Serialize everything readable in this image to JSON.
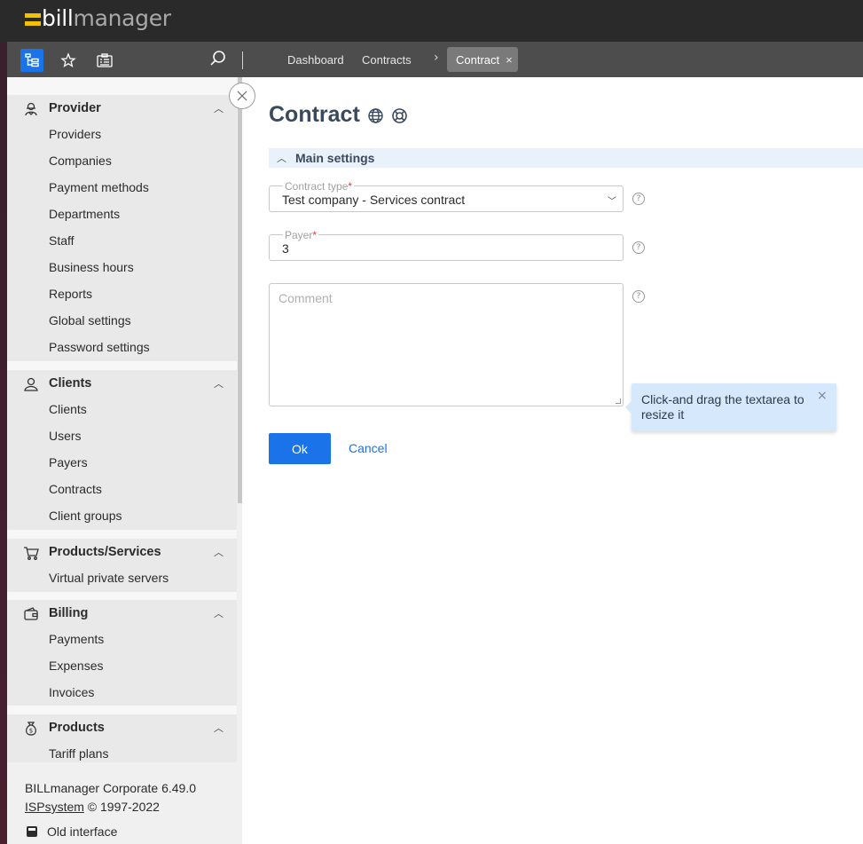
{
  "app": {
    "logo_bill": "bill",
    "logo_manager": "manager",
    "accent": "#1a73e8",
    "logo_color": "#f2c200"
  },
  "toolbar": {
    "icons": [
      "tree-menu-icon",
      "star-icon",
      "clipboard-icon",
      "search-icon"
    ],
    "breadcrumbs": [
      "Dashboard",
      "Contracts"
    ],
    "active_tab": "Contract",
    "active_tab_close": "×"
  },
  "sidebar": {
    "sections": [
      {
        "title": "Provider",
        "icon": "provider-icon",
        "items": [
          "Providers",
          "Companies",
          "Payment methods",
          "Departments",
          "Staff",
          "Business hours",
          "Reports",
          "Global settings",
          "Password settings"
        ]
      },
      {
        "title": "Clients",
        "icon": "clients-icon",
        "items": [
          "Clients",
          "Users",
          "Payers",
          "Contracts",
          "Client groups"
        ]
      },
      {
        "title": "Products/Services",
        "icon": "cart-icon",
        "items": [
          "Virtual private servers"
        ]
      },
      {
        "title": "Billing",
        "icon": "wallet-icon",
        "items": [
          "Payments",
          "Expenses",
          "Invoices"
        ]
      },
      {
        "title": "Products",
        "icon": "money-bag-icon",
        "items": [
          "Tariff plans"
        ]
      }
    ],
    "footer": {
      "version": "BILLmanager Corporate 6.49.0",
      "copyright_link": "ISPsystem",
      "copyright_rest": " © 1997-2022",
      "old_interface": "Old interface"
    }
  },
  "main": {
    "title": "Contract",
    "section": "Main settings",
    "fields": {
      "contract_type": {
        "label": "Contract type",
        "required": "*",
        "value": "Test company - Services contract"
      },
      "payer": {
        "label": "Payer",
        "required": "*",
        "value": "3"
      },
      "comment": {
        "placeholder": "Comment"
      }
    },
    "help": "?",
    "tooltip": {
      "text": "Click-and drag the textarea to resize it",
      "close": "×"
    },
    "buttons": {
      "ok": "Ok",
      "cancel": "Cancel"
    }
  }
}
